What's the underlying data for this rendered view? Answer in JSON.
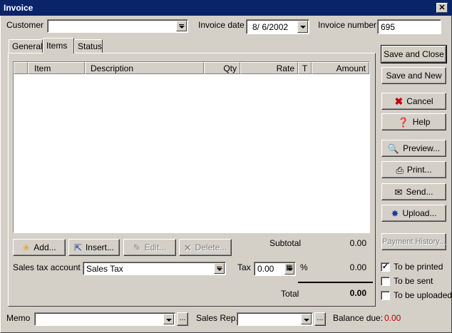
{
  "window": {
    "title": "Invoice",
    "close_glyph": "✕"
  },
  "header": {
    "customer_label": "Customer",
    "customer_value": "",
    "invoice_date_label": "Invoice date",
    "invoice_date_value": "8/ 6/2002",
    "invoice_number_label": "Invoice number",
    "invoice_number_value": "695"
  },
  "tabs": [
    {
      "label": "General",
      "active": false
    },
    {
      "label": "Items",
      "active": true
    },
    {
      "label": "Status",
      "active": false
    }
  ],
  "items_table": {
    "columns": [
      "",
      "Item",
      "Description",
      "Qty",
      "Rate",
      "T",
      "Amount"
    ],
    "rows": []
  },
  "item_buttons": {
    "add": "Add...",
    "insert": "Insert...",
    "edit": "Edit...",
    "delete": "Delete..."
  },
  "totals": {
    "subtotal_label": "Subtotal",
    "subtotal_value": "0.00",
    "tax_label": "Tax",
    "tax_rate": "0.00",
    "percent_sign": "%",
    "tax_value": "0.00",
    "total_label": "Total",
    "total_value": "0.00"
  },
  "sales_tax": {
    "label": "Sales tax account",
    "value": "Sales Tax"
  },
  "side_buttons": {
    "save_close": "Save and Close",
    "save_new": "Save and New",
    "cancel": "Cancel",
    "help": "Help",
    "preview": "Preview...",
    "print": "Print...",
    "send": "Send...",
    "upload": "Upload...",
    "payment_history": "Payment History..."
  },
  "checkboxes": [
    {
      "label": "To be printed",
      "checked": true
    },
    {
      "label": "To be sent",
      "checked": false
    },
    {
      "label": "To be uploaded",
      "checked": false
    }
  ],
  "footer": {
    "memo_label": "Memo",
    "memo_value": "",
    "sales_rep_label": "Sales Rep.",
    "sales_rep_value": "",
    "ellipsis": "...",
    "balance_due_label": "Balance due:",
    "balance_due_value": "0.00"
  },
  "icons": {
    "add": "sparkle-icon",
    "insert": "insert-icon",
    "edit": "pencil-icon",
    "delete": "x-icon",
    "cancel": "red-x-icon",
    "help": "help-icon",
    "preview": "magnifier-icon",
    "print": "printer-icon",
    "send": "envelope-icon",
    "upload": "upload-icon",
    "calculator": "calculator-icon",
    "check": "check-icon"
  },
  "colors": {
    "titlebar": "#0a246a",
    "face": "#d4d0c8",
    "balance_due": "#c00000"
  }
}
